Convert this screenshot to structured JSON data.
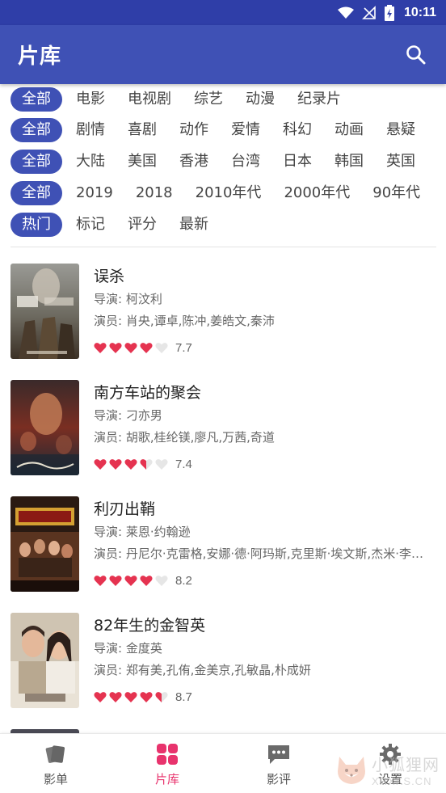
{
  "status_bar": {
    "time": "10:11"
  },
  "app_bar": {
    "title": "片库"
  },
  "filters": [
    {
      "active": "全部",
      "options": [
        "电影",
        "电视剧",
        "综艺",
        "动漫",
        "纪录片"
      ]
    },
    {
      "active": "全部",
      "options": [
        "剧情",
        "喜剧",
        "动作",
        "爱情",
        "科幻",
        "动画",
        "悬疑"
      ]
    },
    {
      "active": "全部",
      "options": [
        "大陆",
        "美国",
        "香港",
        "台湾",
        "日本",
        "韩国",
        "英国"
      ]
    },
    {
      "active": "全部",
      "options": [
        "2019",
        "2018",
        "2010年代",
        "2000年代",
        "90年代"
      ]
    },
    {
      "active": "热门",
      "options": [
        "标记",
        "评分",
        "最新"
      ]
    }
  ],
  "movies": [
    {
      "title": "误杀",
      "director": "导演: 柯汶利",
      "cast": "演员: 肖央,谭卓,陈冲,姜皓文,秦沛",
      "score": "7.7",
      "hearts": [
        1,
        1,
        1,
        1,
        0
      ]
    },
    {
      "title": "南方车站的聚会",
      "director": "导演: 刁亦男",
      "cast": "演员: 胡歌,桂纶镁,廖凡,万茜,奇道",
      "score": "7.4",
      "hearts": [
        1,
        1,
        1,
        0.5,
        0
      ]
    },
    {
      "title": "利刃出鞘",
      "director": "导演: 莱恩·约翰逊",
      "cast": "演员: 丹尼尔·克雷格,安娜·德·阿玛斯,克里斯·埃文斯,杰米·李…",
      "score": "8.2",
      "hearts": [
        1,
        1,
        1,
        1,
        0
      ]
    },
    {
      "title": "82年生的金智英",
      "director": "导演: 金度英",
      "cast": "演员: 郑有美,孔侑,金美京,孔敏晶,朴成妍",
      "score": "8.7",
      "hearts": [
        1,
        1,
        1,
        1,
        0.5
      ]
    }
  ],
  "bottom_nav": [
    {
      "label": "影单",
      "icon": "cards-icon",
      "active": false
    },
    {
      "label": "片库",
      "icon": "grid-icon",
      "active": true
    },
    {
      "label": "影评",
      "icon": "chat-icon",
      "active": false
    },
    {
      "label": "设置",
      "icon": "gear-icon",
      "active": false
    }
  ],
  "watermark": {
    "cn": "小狐狸网",
    "en": "XHXKS.CN"
  },
  "colors": {
    "primary": "#3f51b5",
    "status_bar": "#2f3ea8",
    "accent": "#e8336d",
    "heart": "#e53350"
  }
}
